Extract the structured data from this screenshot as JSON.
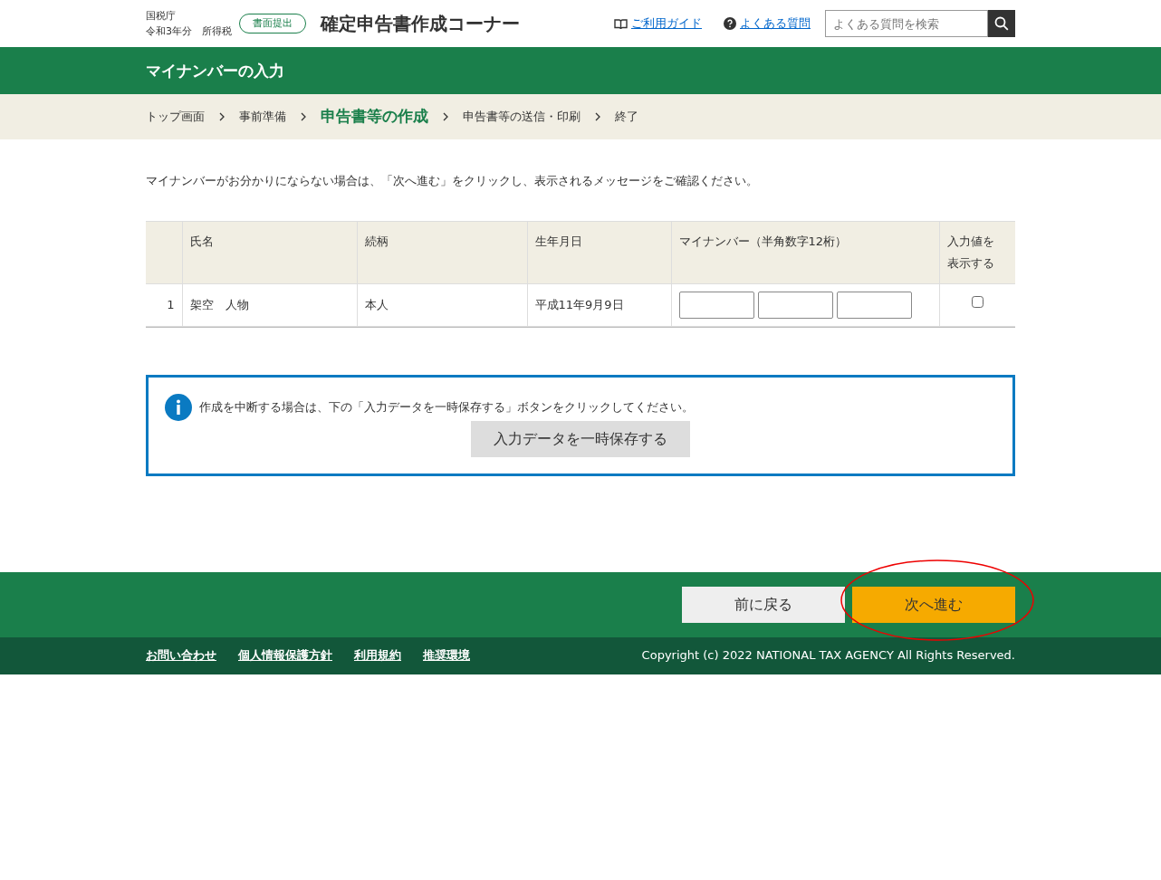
{
  "header": {
    "agency": "国税庁",
    "year": "令和3年分　所得税",
    "badge": "書面提出",
    "title": "確定申告書作成コーナー",
    "links": [
      {
        "kind": "guide",
        "label": "ご利用ガイド"
      },
      {
        "kind": "faq",
        "label": "よくある質問"
      }
    ],
    "search": {
      "placeholder": "よくある質問を検索"
    }
  },
  "page_title": "マイナンバーの入力",
  "steps": [
    {
      "label": "トップ画面",
      "selected": false
    },
    {
      "label": "事前準備",
      "selected": false
    },
    {
      "label": "申告書等の作成",
      "selected": true
    },
    {
      "label": "申告書等の送信・印刷",
      "selected": false
    },
    {
      "label": "終了",
      "selected": false
    }
  ],
  "intro": "マイナンバーがお分かりにならない場合は、「次へ進む」をクリックし、表示されるメッセージをご確認ください。",
  "table": {
    "columns": [
      "",
      "氏名",
      "続柄",
      "生年月日",
      "マイナンバー（半角数字12桁）",
      "入力値を表示する"
    ],
    "rows": [
      {
        "number": "1",
        "name": "架空　人物",
        "relation": "本人",
        "birthday": "平成11年9月9日",
        "show_value": false
      }
    ]
  },
  "notice": {
    "text": "作成を中断する場合は、下の「入力データを一時保存する」ボタンをクリックしてください。",
    "button": "入力データを一時保存する"
  },
  "nav_buttons": [
    {
      "kind": "back",
      "label": "前に戻る"
    },
    {
      "kind": "next",
      "label": "次へ進む",
      "annotated": true
    }
  ],
  "footer": {
    "links": [
      "お問い合わせ",
      "個人情報保護方針",
      "利用規約",
      "推奨環境"
    ],
    "copyright": "Copyright (c) 2022 NATIONAL TAX AGENCY All Rights Reserved."
  }
}
